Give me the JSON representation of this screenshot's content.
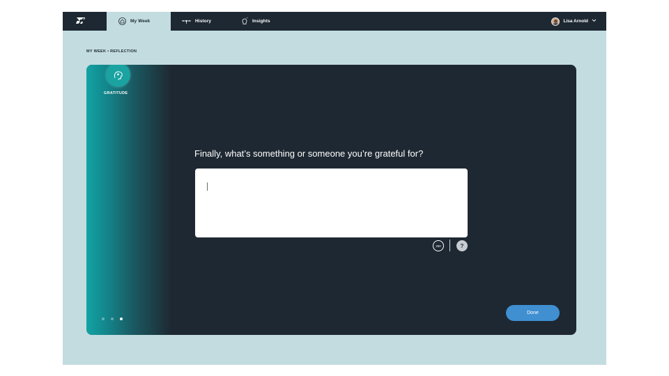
{
  "nav": {
    "tabs": [
      {
        "label": "My Week",
        "icon": "home-icon",
        "active": true
      },
      {
        "label": "History",
        "icon": "timeline-icon",
        "active": false
      },
      {
        "label": "Insights",
        "icon": "lightbulb-icon",
        "active": false
      }
    ],
    "user": {
      "name": "Lisa Arnold",
      "avatar": "user-avatar",
      "menu_icon": "chevron-down-icon"
    }
  },
  "breadcrumb": "MY WEEK  •  REFLECTION",
  "category": {
    "label": "GRATITUDE",
    "icon": "head-with-heart-icon"
  },
  "question": "Finally, what’s something or someone you’re grateful for?",
  "answer": {
    "value": "",
    "placeholder": ""
  },
  "char_counter": "250",
  "help_label": "?",
  "pagination": {
    "total": 3,
    "current": 3
  },
  "done_label": "Done",
  "colors": {
    "nav_bg": "#1d2832",
    "page_bg": "#c3dce0",
    "card_bg": "#1e2832",
    "accent_teal": "#13a3a3",
    "button_blue": "#3f8fd1"
  }
}
